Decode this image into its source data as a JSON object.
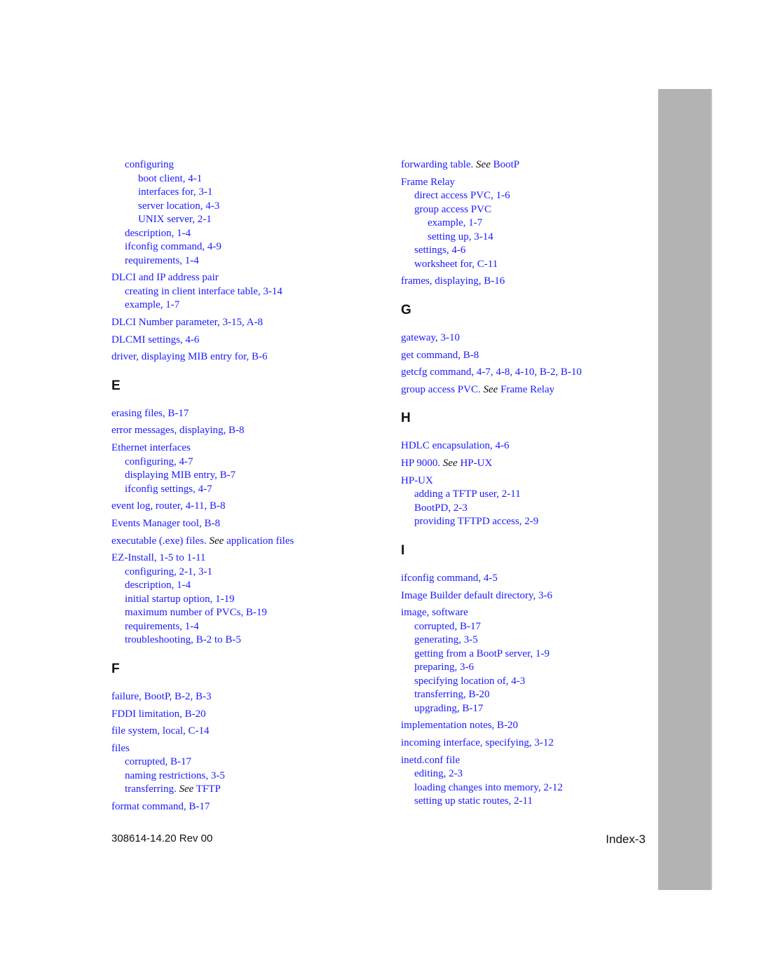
{
  "colors": {
    "link": "#1a1aff",
    "text": "#111111",
    "tab": "#b3b3b3"
  },
  "left_column": [
    {
      "type": "entry",
      "lines": [
        {
          "level": 2,
          "text": "configuring"
        },
        {
          "level": 3,
          "text": "boot client, 4-1"
        },
        {
          "level": 3,
          "text": "interfaces for, 3-1"
        },
        {
          "level": 3,
          "text": "server location, 4-3"
        },
        {
          "level": 3,
          "text": "UNIX server, 2-1"
        },
        {
          "level": 2,
          "text": "description, 1-4"
        },
        {
          "level": 2,
          "text": "ifconfig command, 4-9"
        },
        {
          "level": 2,
          "text": "requirements, 1-4"
        }
      ]
    },
    {
      "type": "entry",
      "lines": [
        {
          "level": 1,
          "text": "DLCI and IP address pair"
        },
        {
          "level": 2,
          "text": "creating in client interface table, 3-14"
        },
        {
          "level": 2,
          "text": "example, 1-7"
        }
      ]
    },
    {
      "type": "entry",
      "lines": [
        {
          "level": 1,
          "text": "DLCI Number parameter, 3-15, A-8"
        }
      ]
    },
    {
      "type": "entry",
      "lines": [
        {
          "level": 1,
          "text": "DLCMI settings, 4-6"
        }
      ]
    },
    {
      "type": "entry",
      "lines": [
        {
          "level": 1,
          "text": "driver, displaying MIB entry for, B-6"
        }
      ]
    },
    {
      "type": "section",
      "letter": "E"
    },
    {
      "type": "entry",
      "lines": [
        {
          "level": 1,
          "text": "erasing files, B-17"
        }
      ]
    },
    {
      "type": "entry",
      "lines": [
        {
          "level": 1,
          "text": "error messages, displaying, B-8"
        }
      ]
    },
    {
      "type": "entry",
      "lines": [
        {
          "level": 1,
          "text": "Ethernet interfaces"
        },
        {
          "level": 2,
          "text": "configuring, 4-7"
        },
        {
          "level": 2,
          "text": "displaying MIB entry, B-7"
        },
        {
          "level": 2,
          "text": "ifconfig settings, 4-7"
        }
      ]
    },
    {
      "type": "entry",
      "lines": [
        {
          "level": 1,
          "text": "event log, router, 4-11, B-8"
        }
      ]
    },
    {
      "type": "entry",
      "lines": [
        {
          "level": 1,
          "text": "Events Manager tool, B-8"
        }
      ]
    },
    {
      "type": "entry",
      "lines": [
        {
          "level": 1,
          "text": "executable (.exe) files.",
          "see": "See",
          "target": "application files"
        }
      ]
    },
    {
      "type": "entry",
      "lines": [
        {
          "level": 1,
          "text": "EZ-Install, 1-5 to 1-11"
        },
        {
          "level": 2,
          "text": "configuring, 2-1, 3-1"
        },
        {
          "level": 2,
          "text": "description, 1-4"
        },
        {
          "level": 2,
          "text": "initial startup option, 1-19"
        },
        {
          "level": 2,
          "text": "maximum number of PVCs, B-19"
        },
        {
          "level": 2,
          "text": "requirements, 1-4"
        },
        {
          "level": 2,
          "text": "troubleshooting, B-2 to B-5"
        }
      ]
    },
    {
      "type": "section",
      "letter": "F"
    },
    {
      "type": "entry",
      "lines": [
        {
          "level": 1,
          "text": "failure, BootP, B-2, B-3"
        }
      ]
    },
    {
      "type": "entry",
      "lines": [
        {
          "level": 1,
          "text": "FDDI limitation, B-20"
        }
      ]
    },
    {
      "type": "entry",
      "lines": [
        {
          "level": 1,
          "text": "file system, local, C-14"
        }
      ]
    },
    {
      "type": "entry",
      "lines": [
        {
          "level": 1,
          "text": "files"
        },
        {
          "level": 2,
          "text": "corrupted, B-17"
        },
        {
          "level": 2,
          "text": "naming restrictions, 3-5"
        },
        {
          "level": 2,
          "text": "transferring.",
          "see": "See",
          "target": "TFTP"
        }
      ]
    },
    {
      "type": "entry",
      "lines": [
        {
          "level": 1,
          "text": "format command, B-17"
        }
      ]
    }
  ],
  "right_column": [
    {
      "type": "entry",
      "lines": [
        {
          "level": 1,
          "text": "forwarding table.",
          "see": "See",
          "target": "BootP"
        }
      ]
    },
    {
      "type": "entry",
      "lines": [
        {
          "level": 1,
          "text": "Frame Relay"
        },
        {
          "level": 2,
          "text": "direct access PVC, 1-6"
        },
        {
          "level": 2,
          "text": "group access PVC"
        },
        {
          "level": 3,
          "text": "example, 1-7"
        },
        {
          "level": 3,
          "text": "setting up, 3-14"
        },
        {
          "level": 2,
          "text": "settings, 4-6"
        },
        {
          "level": 2,
          "text": "worksheet for, C-11"
        }
      ]
    },
    {
      "type": "entry",
      "lines": [
        {
          "level": 1,
          "text": "frames, displaying, B-16"
        }
      ]
    },
    {
      "type": "section",
      "letter": "G"
    },
    {
      "type": "entry",
      "lines": [
        {
          "level": 1,
          "text": "gateway, 3-10"
        }
      ]
    },
    {
      "type": "entry",
      "lines": [
        {
          "level": 1,
          "text": "get command, B-8"
        }
      ]
    },
    {
      "type": "entry",
      "lines": [
        {
          "level": 1,
          "text": "getcfg command, 4-7, 4-8, 4-10, B-2, B-10"
        }
      ]
    },
    {
      "type": "entry",
      "lines": [
        {
          "level": 1,
          "text": "group access PVC.",
          "see": "See",
          "target": "Frame Relay"
        }
      ]
    },
    {
      "type": "section",
      "letter": "H"
    },
    {
      "type": "entry",
      "lines": [
        {
          "level": 1,
          "text": "HDLC encapsulation, 4-6"
        }
      ]
    },
    {
      "type": "entry",
      "lines": [
        {
          "level": 1,
          "text": "HP 9000.",
          "see": "See",
          "target": "HP-UX"
        }
      ]
    },
    {
      "type": "entry",
      "lines": [
        {
          "level": 1,
          "text": "HP-UX"
        },
        {
          "level": 2,
          "text": "adding a TFTP user, 2-11"
        },
        {
          "level": 2,
          "text": "BootPD, 2-3"
        },
        {
          "level": 2,
          "text": "providing TFTPD access, 2-9"
        }
      ]
    },
    {
      "type": "section",
      "letter": "I"
    },
    {
      "type": "entry",
      "lines": [
        {
          "level": 1,
          "text": "ifconfig command, 4-5"
        }
      ]
    },
    {
      "type": "entry",
      "lines": [
        {
          "level": 1,
          "text": "Image Builder default directory, 3-6"
        }
      ]
    },
    {
      "type": "entry",
      "lines": [
        {
          "level": 1,
          "text": "image, software"
        },
        {
          "level": 2,
          "text": "corrupted, B-17"
        },
        {
          "level": 2,
          "text": "generating, 3-5"
        },
        {
          "level": 2,
          "text": "getting from a BootP server, 1-9"
        },
        {
          "level": 2,
          "text": "preparing, 3-6"
        },
        {
          "level": 2,
          "text": "specifying location of, 4-3"
        },
        {
          "level": 2,
          "text": "transferring, B-20"
        },
        {
          "level": 2,
          "text": "upgrading, B-17"
        }
      ]
    },
    {
      "type": "entry",
      "lines": [
        {
          "level": 1,
          "text": "implementation notes, B-20"
        }
      ]
    },
    {
      "type": "entry",
      "lines": [
        {
          "level": 1,
          "text": "incoming interface, specifying, 3-12"
        }
      ]
    },
    {
      "type": "entry",
      "lines": [
        {
          "level": 1,
          "text": "inetd.conf file"
        },
        {
          "level": 2,
          "text": "editing, 2-3"
        },
        {
          "level": 2,
          "text": "loading changes into memory, 2-12"
        },
        {
          "level": 2,
          "text": "setting up static routes, 2-11"
        }
      ]
    }
  ],
  "footer": {
    "doc_number": "308614-14.20 Rev 00",
    "page_label": "Index-3"
  }
}
